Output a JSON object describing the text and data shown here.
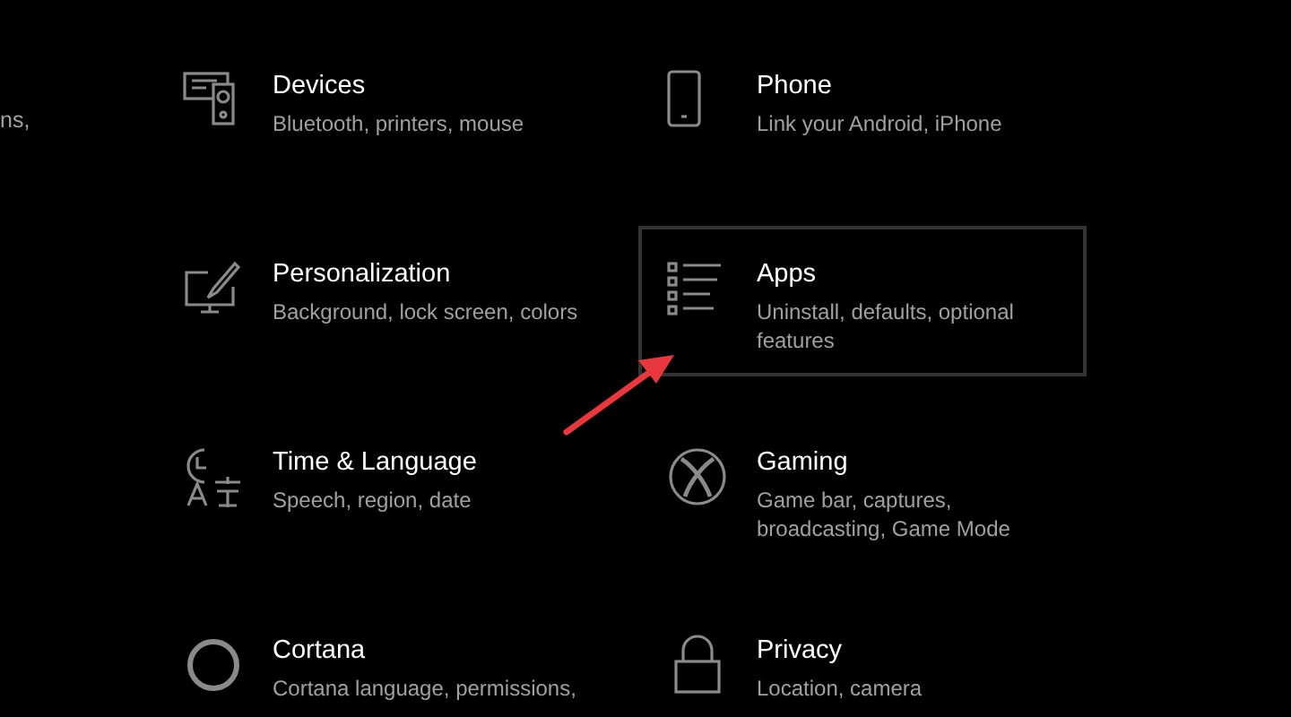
{
  "left_column_fragment": "ns,",
  "categories": [
    {
      "kind": "devices",
      "title": "Devices",
      "subtitle": "Bluetooth, printers, mouse",
      "hovered": false
    },
    {
      "kind": "phone",
      "title": "Phone",
      "subtitle": "Link your Android, iPhone",
      "hovered": false
    },
    {
      "kind": "personalization",
      "title": "Personalization",
      "subtitle": "Background, lock screen, colors",
      "hovered": false
    },
    {
      "kind": "apps",
      "title": "Apps",
      "subtitle": "Uninstall, defaults, optional features",
      "hovered": true
    },
    {
      "kind": "time",
      "title": "Time & Language",
      "subtitle": "Speech, region, date",
      "hovered": false
    },
    {
      "kind": "gaming",
      "title": "Gaming",
      "subtitle": "Game bar, captures, broadcasting, Game Mode",
      "hovered": false
    },
    {
      "kind": "cortana",
      "title": "Cortana",
      "subtitle": "Cortana language, permissions,",
      "hovered": false
    },
    {
      "kind": "privacy",
      "title": "Privacy",
      "subtitle": "Location, camera",
      "hovered": false
    }
  ],
  "annotation": {
    "kind": "arrow",
    "color": "#e8383d"
  }
}
